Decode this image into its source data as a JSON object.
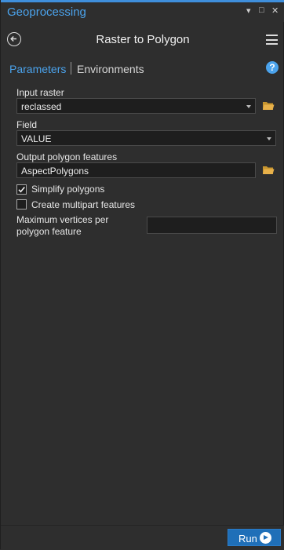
{
  "window": {
    "title": "Geoprocessing",
    "controls": {
      "dropdown": "▾",
      "restore": "□",
      "close": "✕"
    }
  },
  "header": {
    "tool_title": "Raster to Polygon"
  },
  "tabs": {
    "parameters": "Parameters",
    "environments": "Environments"
  },
  "params": {
    "input_raster": {
      "label": "Input raster",
      "value": "reclassed"
    },
    "field": {
      "label": "Field",
      "value": "VALUE"
    },
    "output": {
      "label": "Output polygon features",
      "value": "AspectPolygons"
    },
    "simplify": {
      "label": "Simplify polygons",
      "checked": true
    },
    "multipart": {
      "label": "Create multipart features",
      "checked": false
    },
    "max_vertices": {
      "label_line1": "Maximum vertices per",
      "label_line2": "polygon feature",
      "value": ""
    }
  },
  "footer": {
    "run_label": "Run"
  },
  "colors": {
    "accent": "#4ba3ec",
    "run_button": "#1f6fb8",
    "panel_bg": "#2e2e2e",
    "folder": "#e8b14a"
  }
}
